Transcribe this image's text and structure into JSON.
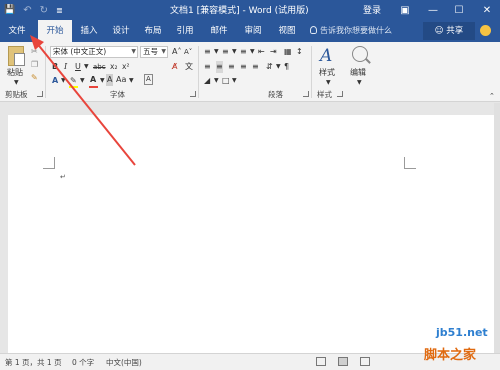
{
  "titlebar": {
    "save_glyph": "💾",
    "undo_glyph": "↶",
    "redo_glyph": "↻",
    "customize_glyph": "≣",
    "title": "文档1 [兼容模式] - Word (试用版)",
    "login": "登录",
    "ribbon_display_glyph": "▣",
    "minimize_glyph": "—",
    "maximize_glyph": "☐",
    "close_glyph": "✕"
  },
  "tabs": [
    {
      "label": "文件"
    },
    {
      "label": "开始"
    },
    {
      "label": "插入"
    },
    {
      "label": "设计"
    },
    {
      "label": "布局"
    },
    {
      "label": "引用"
    },
    {
      "label": "邮件"
    },
    {
      "label": "审阅"
    },
    {
      "label": "视图"
    }
  ],
  "active_tab": "开始",
  "tellme": "告诉我你想要做什么",
  "share": "共享",
  "ribbon": {
    "clipboard": {
      "paste_label": "粘贴",
      "group_label": "剪贴板"
    },
    "font": {
      "font_name": "宋体 (中文正文)",
      "font_size": "五号",
      "bold": "B",
      "italic": "I",
      "underline": "U",
      "strike": "abc",
      "subscript": "x₂",
      "superscript": "x²",
      "font_color": "A",
      "highlight": "A",
      "char_shade": "A",
      "case": "Aa",
      "grow": "A˄",
      "shrink": "A˅",
      "clear": "A̸",
      "phonetic": "文",
      "group_label": "字体"
    },
    "paragraph": {
      "group_label": "段落"
    },
    "styles": {
      "label": "样式",
      "group_label": "样式"
    },
    "editing": {
      "label": "编辑"
    }
  },
  "document": {
    "paragraph_mark": "↵"
  },
  "statusbar": {
    "page": "第 1 页，共 1 页",
    "words": "0 个字",
    "language": "中文(中国)"
  },
  "watermark": {
    "line1": "jb51.net",
    "line2": "脚本之家"
  },
  "colors": {
    "brand": "#2b579a",
    "arrow": "#e8453c",
    "font_color_bar": "#e8453c",
    "highlight_bar": "#ffff00"
  }
}
